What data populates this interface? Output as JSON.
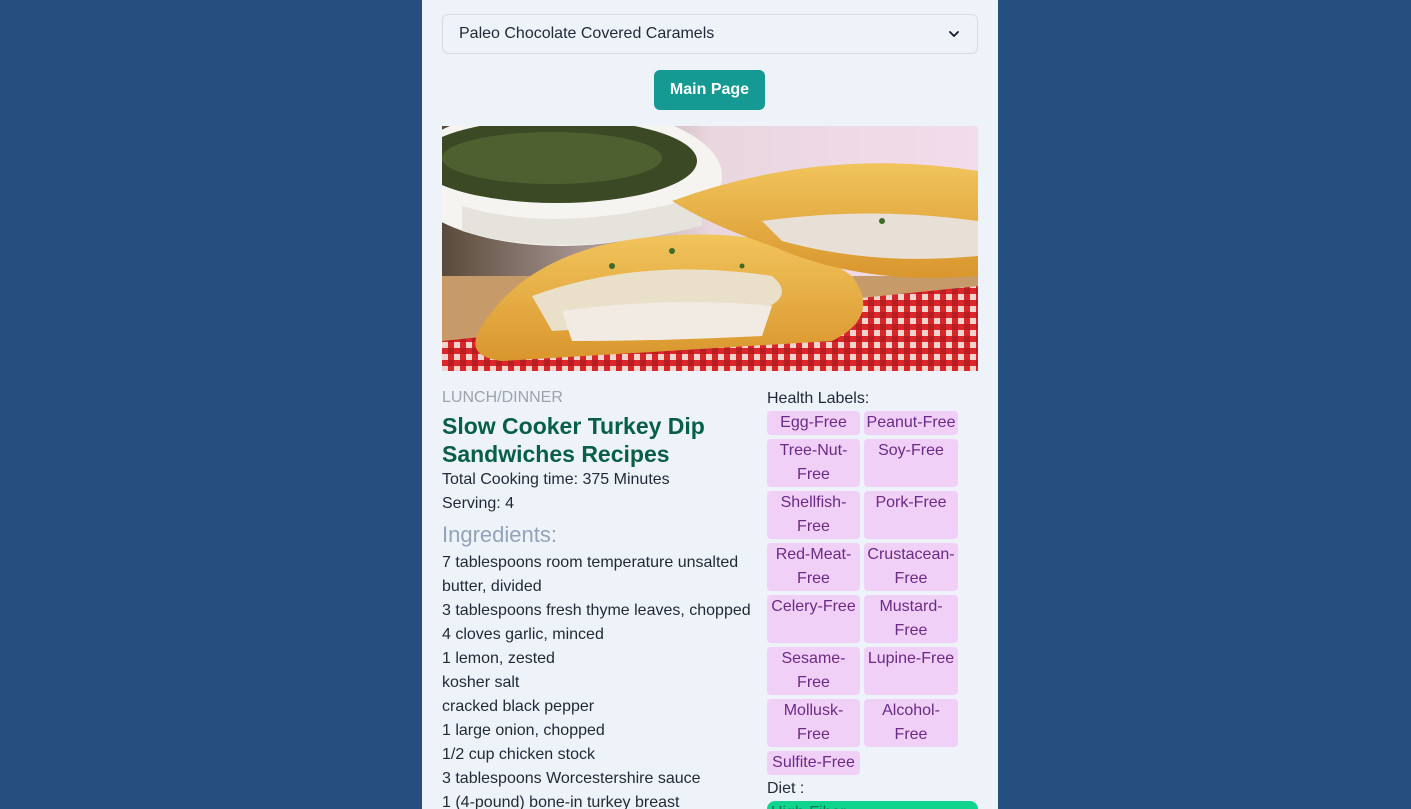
{
  "recipe_select": {
    "value": "Paleo Chocolate Covered Caramels"
  },
  "main_button": {
    "label": "Main Page"
  },
  "recipe": {
    "meal_type": "LUNCH/DINNER",
    "title": "Slow Cooker Turkey Dip Sandwiches Recipes",
    "total_time": "Total Cooking time: 375 Minutes",
    "serving": "Serving: 4",
    "ingredients_heading": "Ingredients:",
    "ingredients": [
      "7 tablespoons room temperature unsalted butter, divided",
      "3 tablespoons fresh thyme leaves, chopped",
      "4 cloves garlic, minced",
      "1 lemon, zested",
      "kosher salt",
      "cracked black pepper",
      "1 large onion, chopped",
      "1/2 cup chicken stock",
      "3 tablespoons Worcestershire sauce",
      "1 (4-pound) bone-in turkey breast"
    ],
    "health_heading": "Health Labels:",
    "health_labels": [
      "Egg-Free",
      "Peanut-Free",
      "Tree-Nut-Free",
      "Soy-Free",
      "Shellfish-Free",
      "Pork-Free",
      "Red-Meat-Free",
      "Crustacean-Free",
      "Celery-Free",
      "Mustard-Free",
      "Sesame-Free",
      "Lupine-Free",
      "Mollusk-Free",
      "Alcohol-Free",
      "Sulfite-Free"
    ],
    "diet_heading": "Diet :",
    "diet_labels": [
      "High-Fiber"
    ]
  },
  "colors": {
    "page_bg": "#264f80",
    "panel_bg": "#eef2f9",
    "button": "#149a92",
    "title": "#065f46",
    "label_bg": "#f0d0f6",
    "label_text": "#6b2a86",
    "diet_bg": "#10d48e"
  },
  "icons": {
    "select_arrow": "chevron-down-icon"
  }
}
